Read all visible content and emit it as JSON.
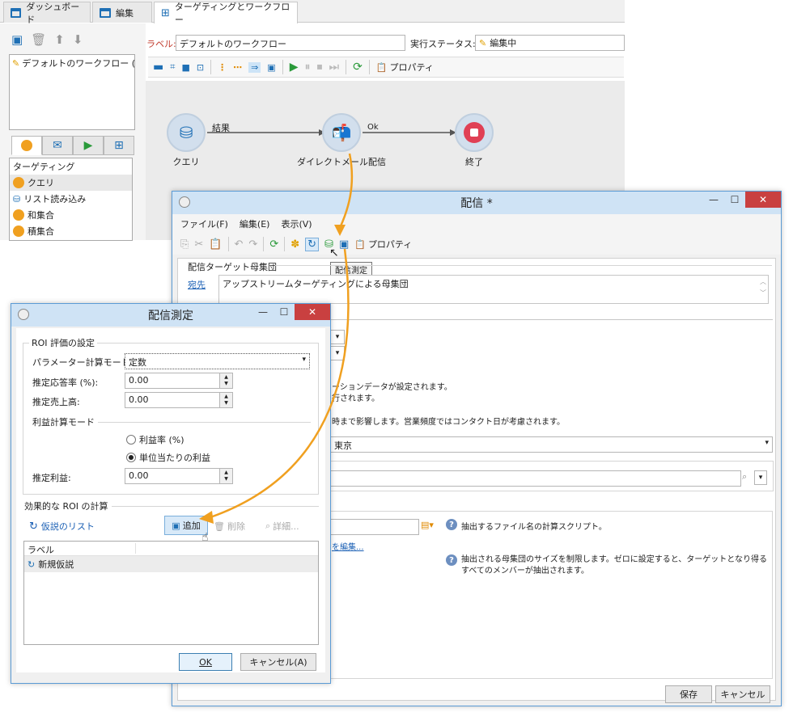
{
  "tabs": [
    {
      "label": "ダッシュボード"
    },
    {
      "label": "編集"
    },
    {
      "label": "ターゲティングとワークフロー"
    }
  ],
  "workflow": {
    "label_caption": "ラベル:",
    "label_value": "デフォルトのワークフロー",
    "status_caption": "実行ステータス:",
    "status_value": "編集中",
    "properties_label": "プロパティ",
    "list_item": "デフォルトのワークフロー (W...",
    "nodes": {
      "query": "クエリ",
      "delivery": "ダイレクトメール配信",
      "end": "終了"
    },
    "transitions": {
      "result": "結果",
      "ok": "Ok"
    }
  },
  "palette": {
    "header": "ターゲティング",
    "items": [
      "クエリ",
      "リスト読み込み",
      "和集合",
      "積集合"
    ]
  },
  "delivery_window": {
    "title": "配信 *",
    "menu": [
      "ファイル(F)",
      "編集(E)",
      "表示(V)"
    ],
    "properties_label": "プロパティ",
    "tooltip": "配信測定",
    "target_section": "配信ターゲット母集団",
    "to_link": "宛先",
    "to_value": "アップストリームターゲティングによる母集団",
    "text1": "ーションデータが設定されます。",
    "text2": "行されます。",
    "text3": "時まで影響します。営業頻度ではコンタクト日が考慮されます。",
    "timezone": "東京",
    "help_filename": "抽出するファイル名の計算スクリプト。",
    "edit_link": "を編集...",
    "help_limit": "抽出される母集団のサイズを制限します。ゼロに設定すると、ターゲットとなり得るすべてのメンバーが抽出されます。",
    "save": "保存",
    "cancel": "キャンセル"
  },
  "roi_dialog": {
    "title": "配信測定",
    "group_roi": "ROI 評価の設定",
    "param_mode_label": "パラメーター計算モード:",
    "param_mode_value": "定数",
    "response_rate_label": "推定応答率 (%):",
    "response_rate_value": "0.00",
    "revenue_label": "推定売上高:",
    "revenue_value": "0.00",
    "profit_mode_group": "利益計算モード",
    "radio_margin": "利益率 (%)",
    "radio_unit": "単位当たりの利益",
    "est_profit_label": "推定利益:",
    "est_profit_value": "0.00",
    "effective_group": "効果的な ROI の計算",
    "hypothesis_list": "仮説のリスト",
    "add": "追加",
    "delete": "削除",
    "detail": "詳細...",
    "col_label": "ラベル",
    "row1": "新規仮説",
    "ok": "OK",
    "cancel": "キャンセル(A)"
  },
  "colors": {
    "accent": "#f0a020",
    "link": "#1a5fb4",
    "close_button": "#c94040",
    "titlebar": "#cfe3f5"
  }
}
